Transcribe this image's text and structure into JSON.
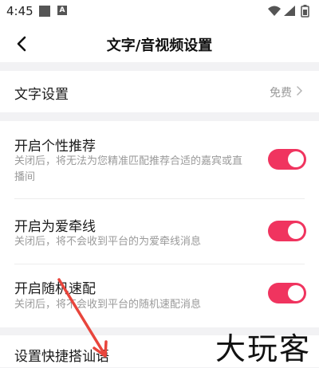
{
  "status_bar": {
    "time": "4:45",
    "a_icon_letter": "A",
    "icons": [
      "photo-icon",
      "a-badge-icon",
      "wifi-icon",
      "signal-icon",
      "battery-icon"
    ]
  },
  "header": {
    "title": "文字/音视频设置",
    "back_icon": "back-chevron-icon"
  },
  "text_settings": {
    "label": "文字设置",
    "value": "免费"
  },
  "toggles": [
    {
      "title": "开启个性推荐",
      "desc": "关闭后，将无法为您精准匹配推荐合适的嘉宾或直播间",
      "on": true
    },
    {
      "title": "开启为爱牵线",
      "desc": "关闭后，将不会收到平台的为爱牵线消息",
      "on": true
    },
    {
      "title": "开启随机速配",
      "desc": "关闭后，将不会收到平台的随机速配消息",
      "on": true
    }
  ],
  "quick_greeting": {
    "label": "设置快捷搭讪语"
  },
  "watermark": {
    "text": "大玩客"
  },
  "colors": {
    "accent": "#f0345f",
    "arrow": "#e8453c"
  }
}
